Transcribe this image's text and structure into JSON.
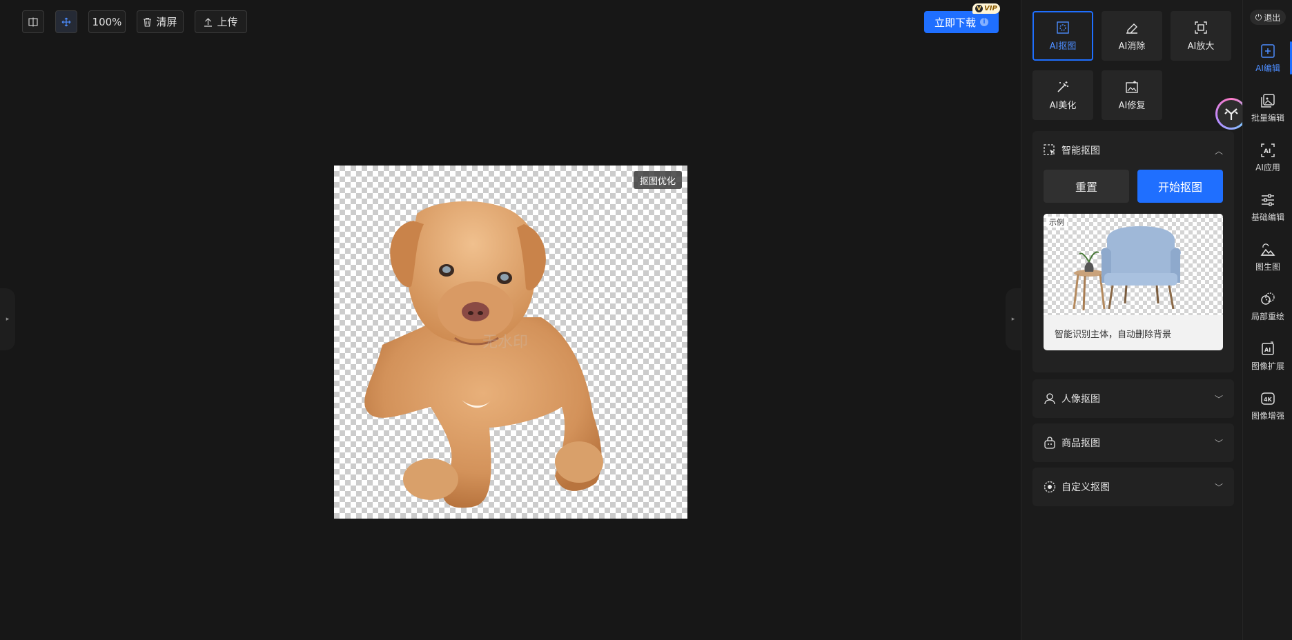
{
  "toolbar": {
    "zoom": "100%",
    "clear_label": "清屏",
    "upload_label": "上传"
  },
  "header": {
    "download_label": "立即下载",
    "vip_badge": "VIP",
    "vip_v": "V"
  },
  "canvas": {
    "optimize_label": "抠图优化",
    "watermark": "无水印"
  },
  "tools": [
    {
      "label": "AI抠图",
      "icon": "cutout-icon",
      "active": true
    },
    {
      "label": "AI消除",
      "icon": "eraser-icon",
      "active": false
    },
    {
      "label": "AI放大",
      "icon": "enlarge-icon",
      "active": false
    },
    {
      "label": "AI美化",
      "icon": "magic-wand-icon",
      "active": false
    },
    {
      "label": "AI修复",
      "icon": "repair-icon",
      "active": false
    }
  ],
  "smart_cutout": {
    "title": "智能抠图",
    "reset_label": "重置",
    "start_label": "开始抠图",
    "example_tag": "示例",
    "example_desc": "智能识别主体，自动删除背景"
  },
  "sections": {
    "portrait": "人像抠图",
    "product": "商品抠图",
    "custom": "自定义抠图"
  },
  "nav": {
    "logout": "退出",
    "items": [
      {
        "label": "AI编辑",
        "icon": "ai-edit-icon"
      },
      {
        "label": "批量编辑",
        "icon": "batch-edit-icon"
      },
      {
        "label": "AI应用",
        "icon": "ai-app-icon"
      },
      {
        "label": "基础编辑",
        "icon": "sliders-icon"
      },
      {
        "label": "图生图",
        "icon": "image-to-image-icon"
      },
      {
        "label": "局部重绘",
        "icon": "repaint-icon"
      },
      {
        "label": "图像扩展",
        "icon": "expand-icon"
      },
      {
        "label": "图像增强",
        "icon": "4k-icon"
      }
    ]
  },
  "colors": {
    "accent": "#1f6fff",
    "background": "#171717",
    "panel": "#1b1b1b"
  }
}
